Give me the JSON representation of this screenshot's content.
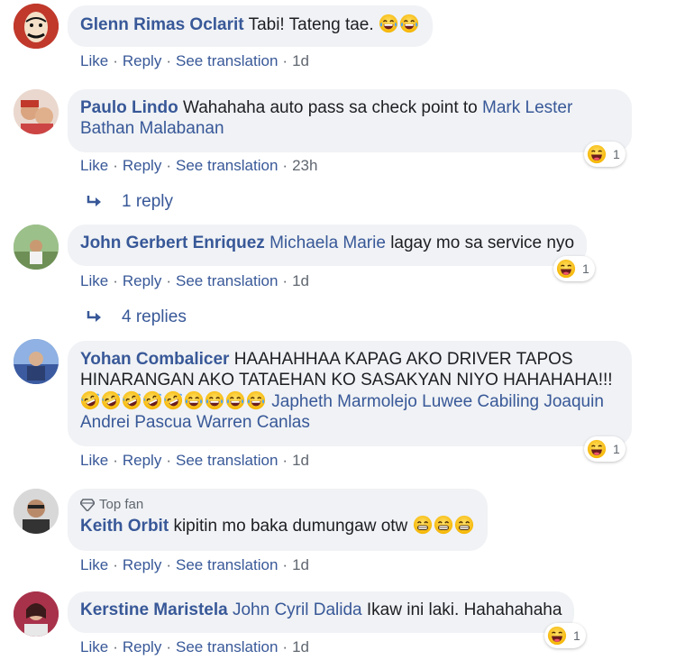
{
  "actions": {
    "like": "Like",
    "reply": "Reply",
    "translate": "See translation",
    "sep": "·"
  },
  "comments": [
    {
      "author": "Glenn Rimas Oclarit",
      "text": "Tabi! Tateng tae.",
      "time": "1d"
    },
    {
      "author": "Paulo Lindo",
      "text": "Wahahaha auto pass sa check point to",
      "mention": "Mark Lester Bathan Malabanan",
      "time": "23h",
      "reaction_count": "1",
      "replies": "1 reply"
    },
    {
      "author": "John Gerbert Enriquez",
      "mention": "Michaela Marie",
      "text": "lagay mo sa service nyo",
      "time": "1d",
      "reaction_count": "1",
      "replies": "4 replies"
    },
    {
      "author": "Yohan Combalicer",
      "text": "HAAHAHHAA KAPAG AKO DRIVER TAPOS HINARANGAN AKO TATAEHAN KO SASAKYAN NIYO HAHAHAHA!!!",
      "mention1": "Japheth Marmolejo",
      "mention2": "Luwee Cabiling",
      "mention3": "Joaquin Andrei Pascua",
      "mention4": "Warren Canlas",
      "time": "1d",
      "reaction_count": "1"
    },
    {
      "badge": "Top fan",
      "author": "Keith Orbit",
      "text": "kipitin mo baka dumungaw otw",
      "time": "1d"
    },
    {
      "author": "Kerstine Maristela",
      "mention": "John Cyril Dalida",
      "text": "Ikaw ini laki. Hahahahaha",
      "time": "1d",
      "reaction_count": "1"
    }
  ]
}
